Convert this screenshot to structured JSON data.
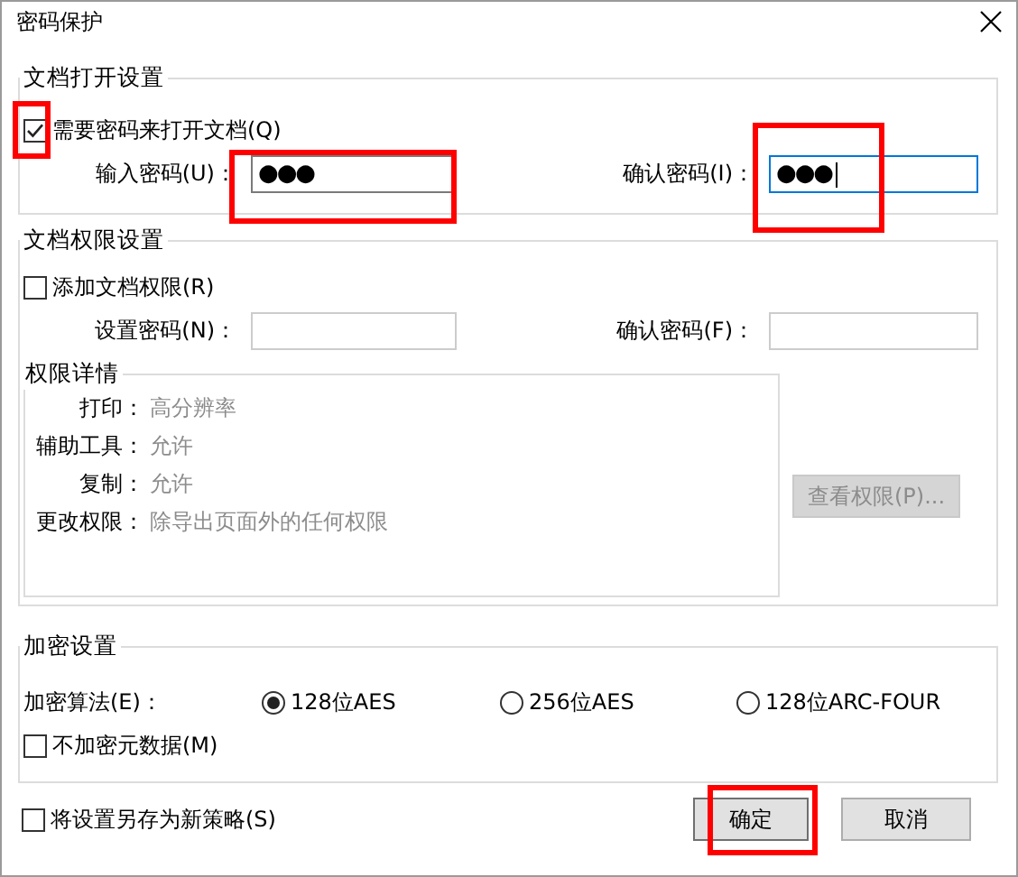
{
  "window": {
    "title": "密码保护"
  },
  "open_settings": {
    "title": "文档打开设置",
    "require_password": {
      "label": "需要密码来打开文档(Q)",
      "checked": true,
      "highlighted": true
    },
    "password": {
      "label": "输入密码(U)：",
      "value": "●●●",
      "focused": false,
      "highlighted": true
    },
    "confirm": {
      "label": "确认密码(I)：",
      "value": "●●●",
      "focused": true,
      "highlighted": true
    }
  },
  "permission_settings": {
    "title": "文档权限设置",
    "add_permissions": {
      "label": "添加文档权限(R)",
      "checked": false
    },
    "password": {
      "label": "设置密码(N)：",
      "disabled": true
    },
    "confirm": {
      "label": "确认密码(F)：",
      "disabled": true
    },
    "details": {
      "title": "权限详情",
      "rows": [
        {
          "label": "打印：",
          "value": "高分辨率"
        },
        {
          "label": "辅助工具：",
          "value": "允许"
        },
        {
          "label": "复制：",
          "value": "允许"
        },
        {
          "label": "更改权限：",
          "value": "除导出页面外的任何权限"
        }
      ]
    },
    "view_button": {
      "label": "查看权限(P)...",
      "disabled": true
    }
  },
  "encryption": {
    "title": "加密设置",
    "algorithm_label": "加密算法(E)：",
    "options": [
      {
        "label": "128位AES",
        "selected": true
      },
      {
        "label": "256位AES",
        "selected": false
      },
      {
        "label": "128位ARC-FOUR",
        "selected": false
      }
    ],
    "no_metadata": {
      "label": "不加密元数据(M)",
      "checked": false
    }
  },
  "footer": {
    "save_policy": {
      "label": "将设置另存为新策略(S)",
      "checked": false
    },
    "buttons": [
      {
        "label": "确定",
        "kind": "default",
        "highlighted": true
      },
      {
        "label": "取消",
        "kind": "normal",
        "highlighted": false
      }
    ]
  }
}
